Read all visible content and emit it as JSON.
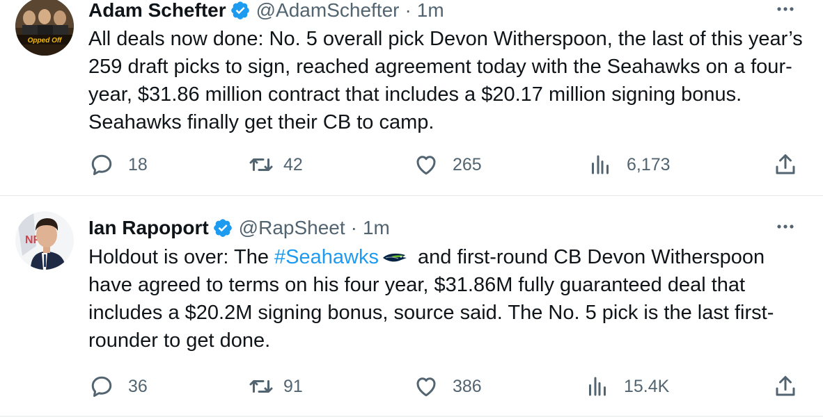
{
  "tweets": [
    {
      "author_name": "Adam Schefter",
      "handle": "@AdamSchefter",
      "separator": "·",
      "time": "1m",
      "text": "All deals now done: No. 5 overall pick Devon Witherspoon, the last of this year’s 259 draft picks to sign, reached agreement today with the Seahawks on a four-year, $31.86 million contract that includes a $20.17 million signing bonus. Seahawks finally get their CB to camp.",
      "avatar_caption": "Opped Off",
      "replies": "18",
      "reposts": "42",
      "likes": "265",
      "views": "6,173"
    },
    {
      "author_name": "Ian Rapoport",
      "handle": "@RapSheet",
      "separator": "·",
      "time": "1m",
      "text_before": "Holdout is over: The ",
      "hashtag": "#Seahawks",
      "text_after": " and first-round CB Devon Witherspoon have agreed to terms on his four year, $31.86M fully guaranteed deal that includes a $20.2M signing bonus, source said. The No. 5 pick is the last first-rounder to get done.",
      "replies": "36",
      "reposts": "91",
      "likes": "386",
      "views": "15.4K"
    }
  ],
  "icons": {
    "verified": "verified-badge-icon",
    "more": "more-options-icon",
    "reply": "reply-icon",
    "repost": "repost-icon",
    "like": "like-icon",
    "views": "views-icon",
    "share": "share-icon",
    "hashflag": "seahawks-hashflag-icon"
  },
  "colors": {
    "text": "#0f1419",
    "secondary": "#536471",
    "accent": "#1d9bf0",
    "verified": "#1d9bf0",
    "divider": "#e3e7ea"
  }
}
